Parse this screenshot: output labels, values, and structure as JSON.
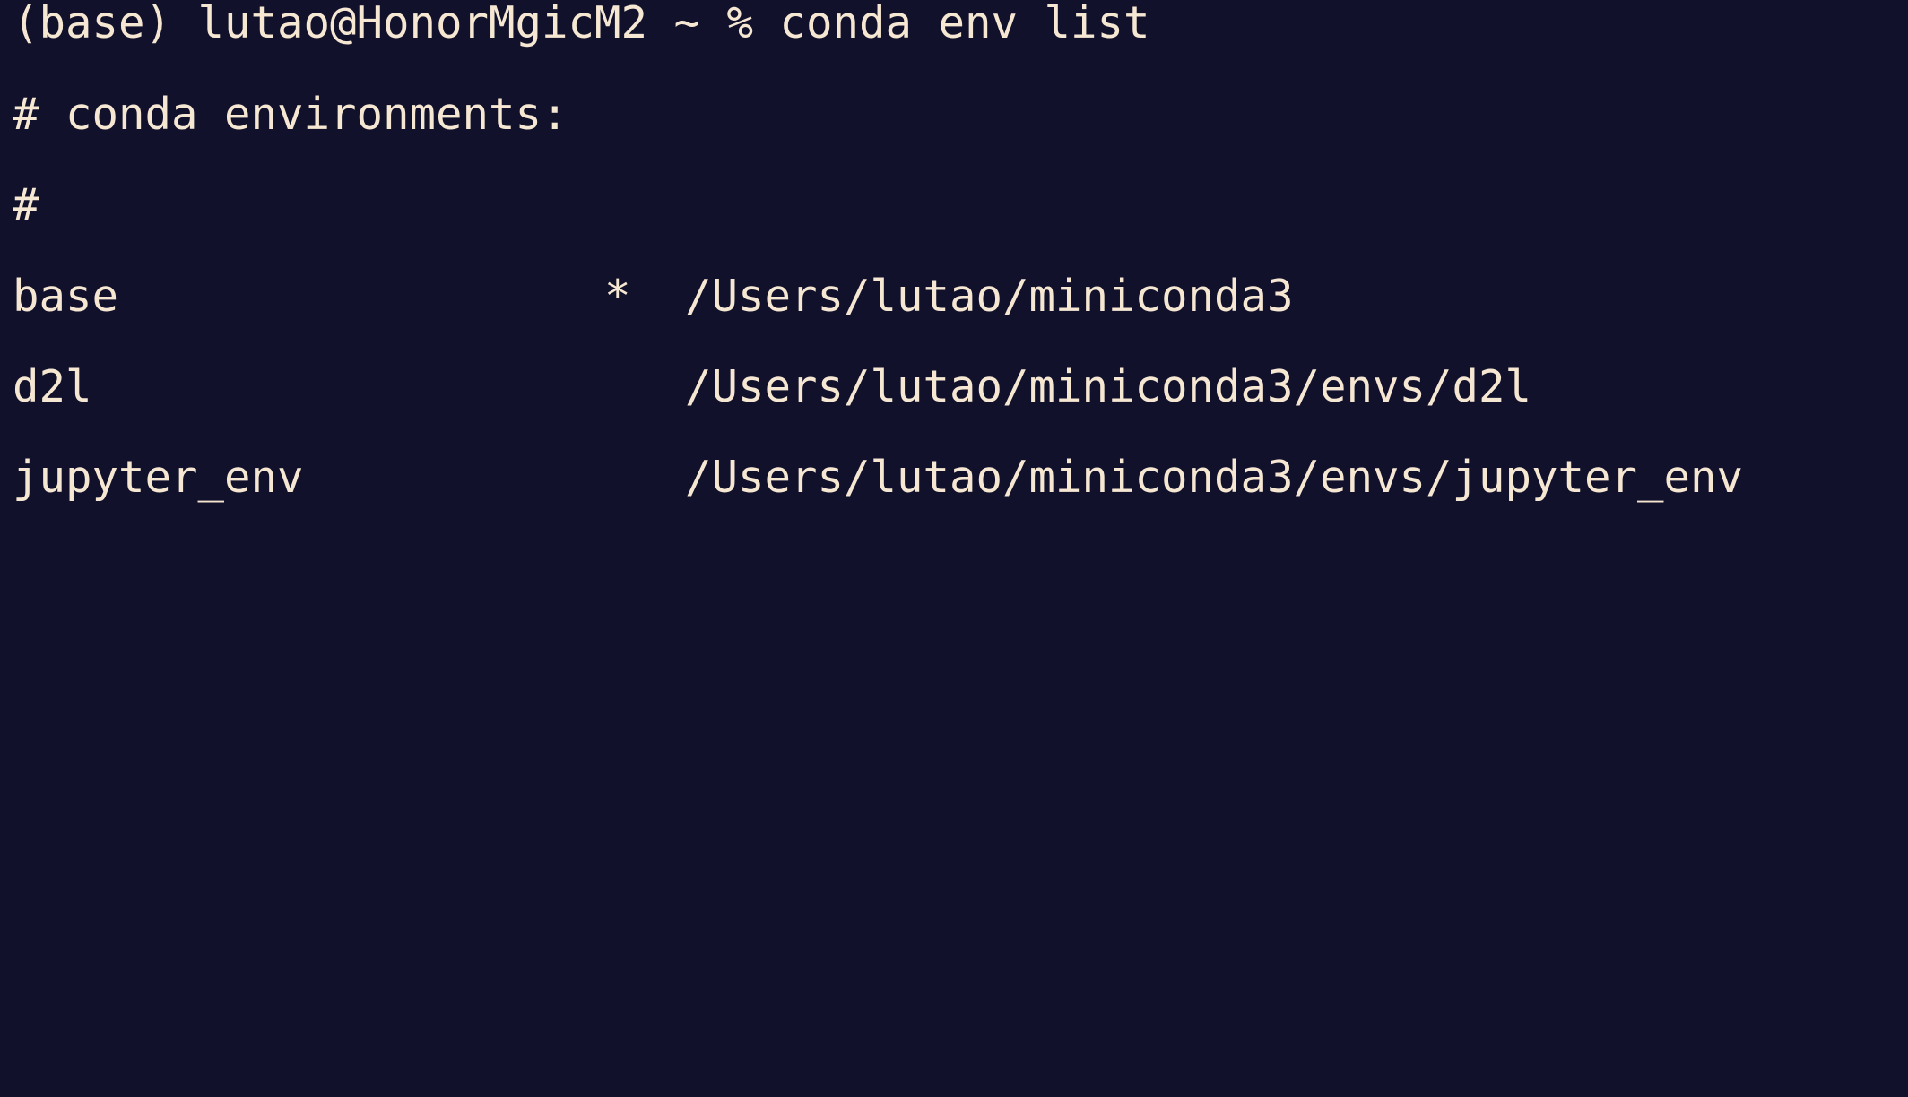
{
  "terminal": {
    "prompt": "(base) lutao@HonorMgicM2 ~ % ",
    "command": "conda env list",
    "comment_header": "# conda environments:",
    "comment_blank": "#",
    "environments": [
      {
        "name": "base",
        "marker": "*",
        "path": "/Users/lutao/miniconda3"
      },
      {
        "name": "d2l",
        "marker": "",
        "path": "/Users/lutao/miniconda3/envs/d2l"
      },
      {
        "name": "jupyter_env",
        "marker": "",
        "path": "/Users/lutao/miniconda3/envs/jupyter_env"
      }
    ]
  },
  "colors": {
    "background": "#11112b",
    "foreground": "#f6e7d3"
  }
}
